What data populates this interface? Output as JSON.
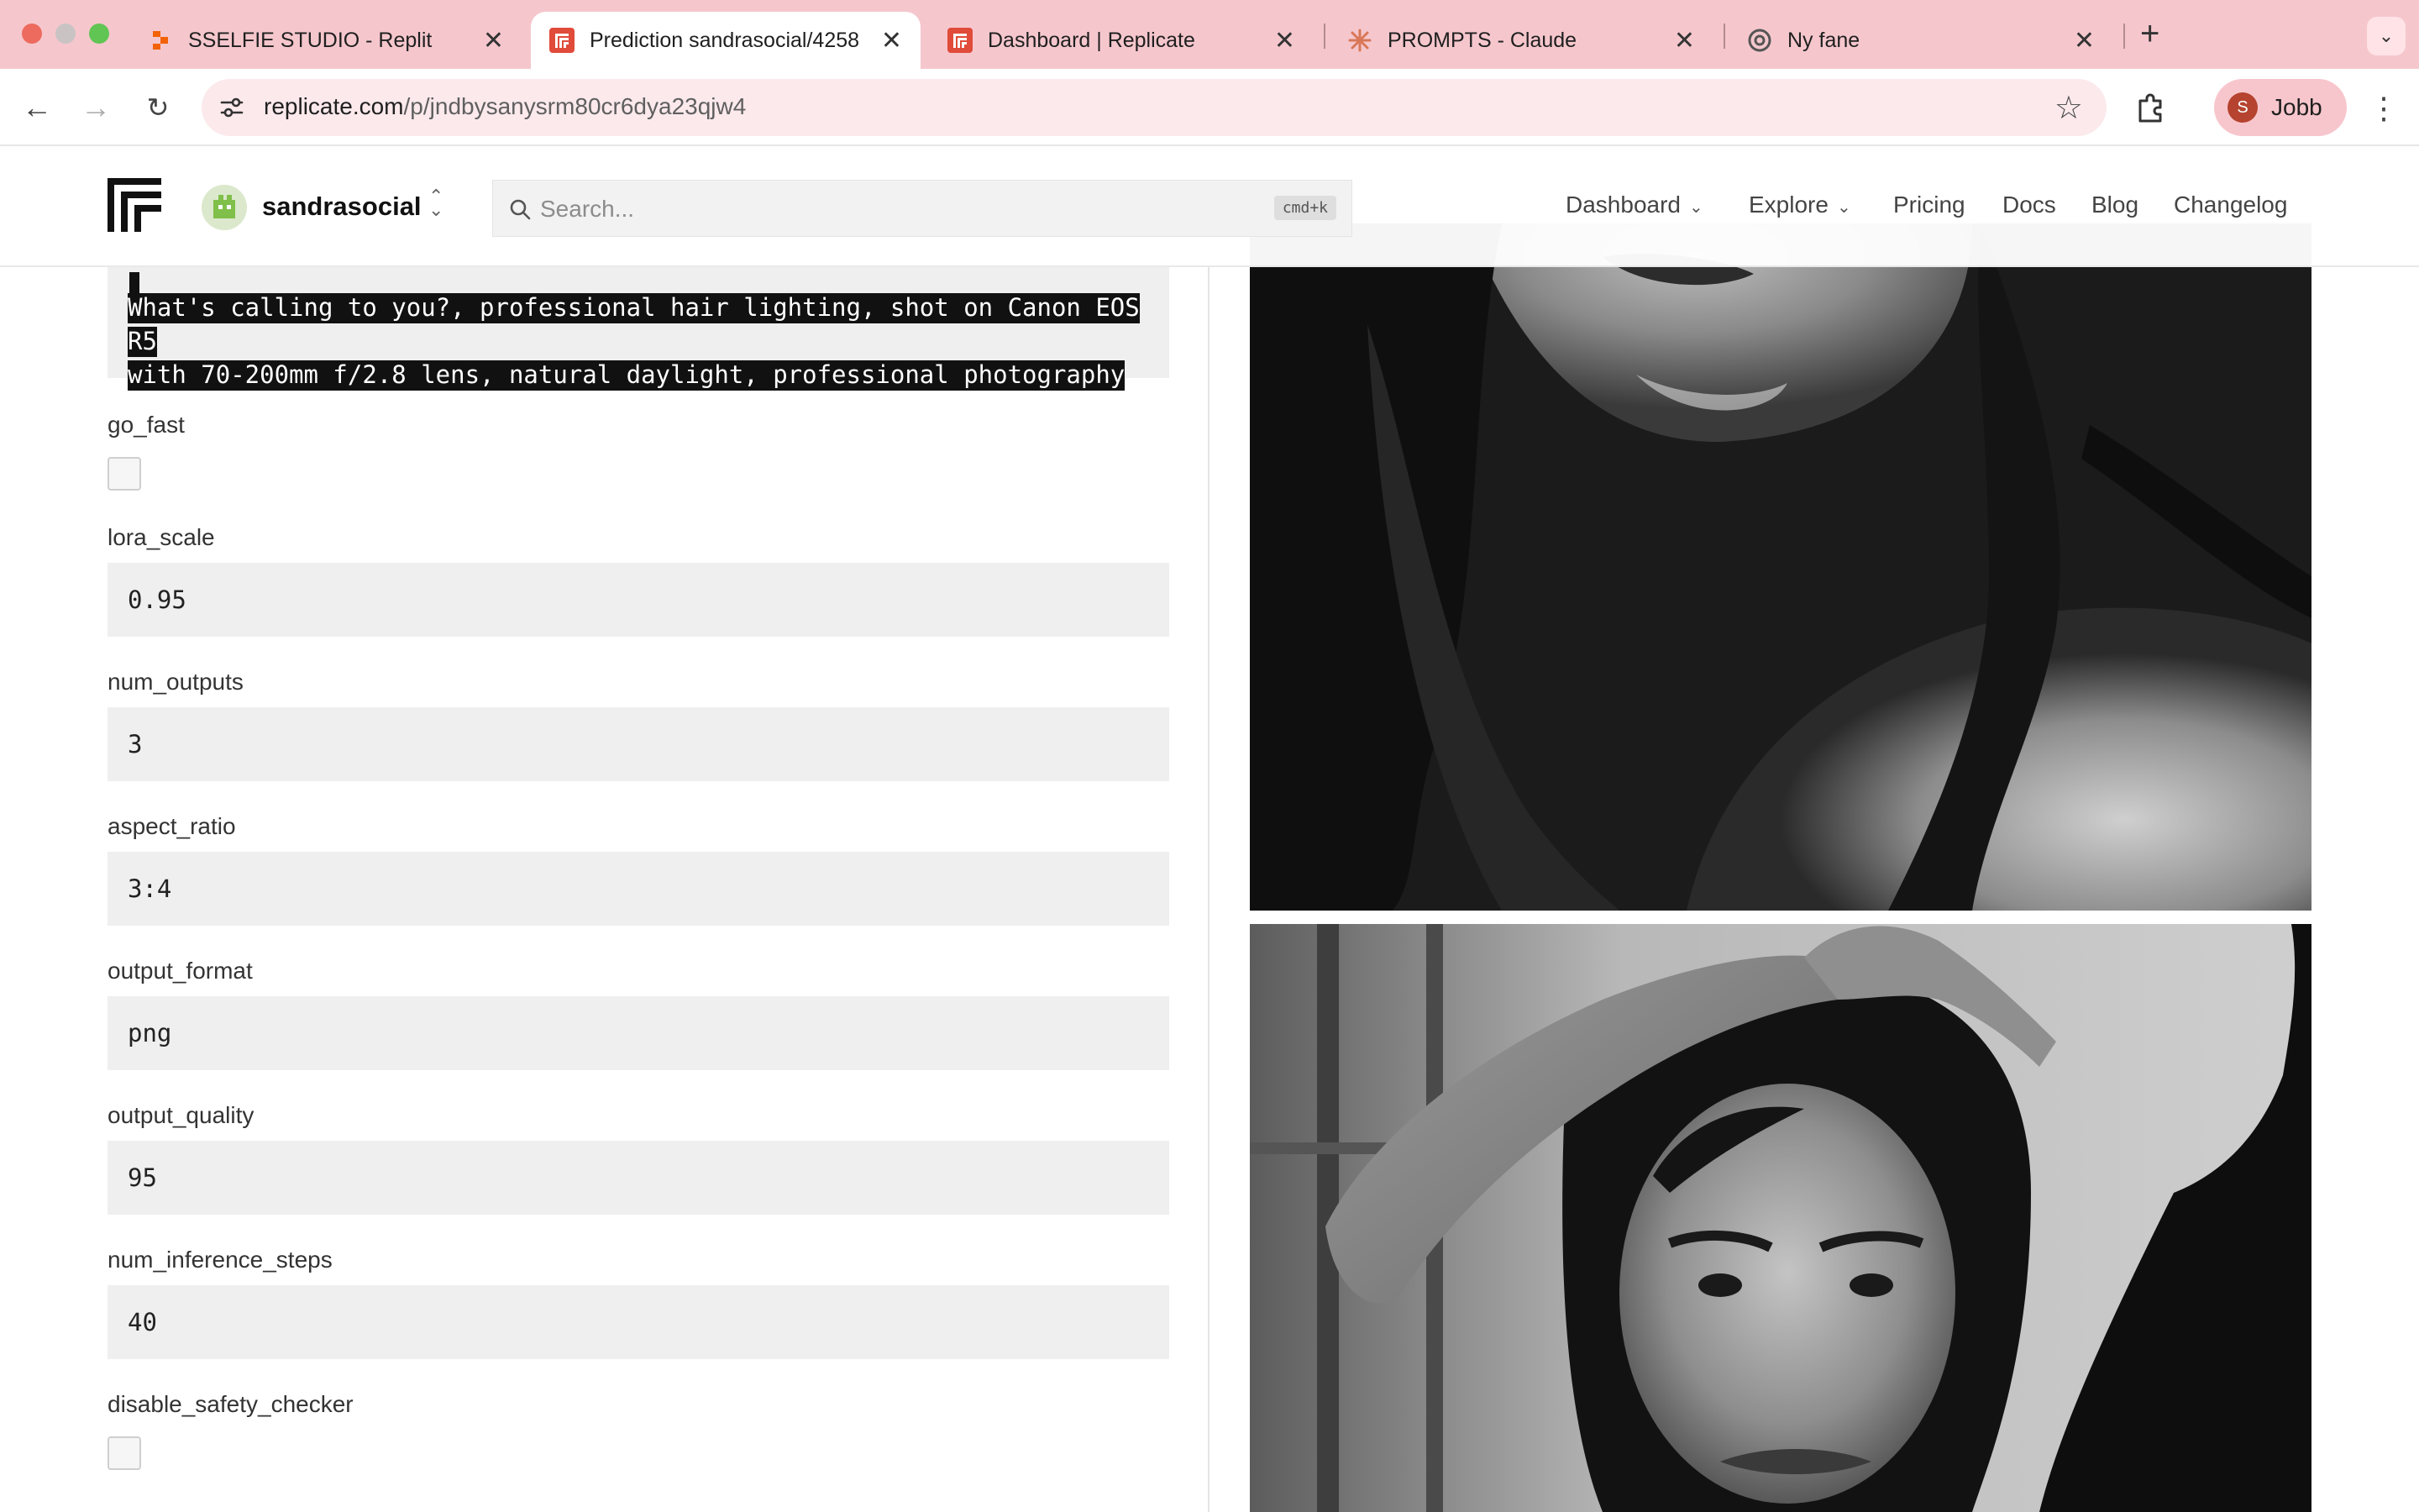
{
  "browser": {
    "tabs": [
      {
        "title": "SSELFIE STUDIO - Replit",
        "icon": "replit-icon"
      },
      {
        "title": "Prediction sandrasocial/4258",
        "icon": "replicate-icon"
      },
      {
        "title": "Dashboard | Replicate",
        "icon": "replicate-icon"
      },
      {
        "title": "PROMPTS - Claude",
        "icon": "claude-icon"
      },
      {
        "title": "Ny fane",
        "icon": "chrome-icon"
      }
    ],
    "url_host": "replicate.com",
    "url_path": "/p/jndbysanysrm80cr6dya23qjw4",
    "profile_initial": "S",
    "profile_name": "Jobb"
  },
  "site": {
    "account_name": "sandrasocial",
    "search_placeholder": "Search...",
    "search_shortcut": "cmd+k",
    "nav": [
      "Dashboard",
      "Explore",
      "Pricing",
      "Docs",
      "Blog",
      "Changelog"
    ]
  },
  "form": {
    "prompt_line1": "What's calling to you?, professional hair lighting, shot on Canon EOS R5",
    "prompt_line2": "with 70-200mm f/2.8 lens, natural daylight, professional photography",
    "fields": {
      "go_fast": {
        "label": "go_fast",
        "checked": false
      },
      "lora_scale": {
        "label": "lora_scale",
        "value": "0.95"
      },
      "num_outputs": {
        "label": "num_outputs",
        "value": "3"
      },
      "aspect_ratio": {
        "label": "aspect_ratio",
        "value": "3:4"
      },
      "output_format": {
        "label": "output_format",
        "value": "png"
      },
      "output_quality": {
        "label": "output_quality",
        "value": "95"
      },
      "num_inference_steps": {
        "label": "num_inference_steps",
        "value": "40"
      },
      "disable_safety_checker": {
        "label": "disable_safety_checker",
        "checked": false
      }
    }
  },
  "colors": {
    "tabstrip": "#f5c7cd",
    "omnibox": "#fbe9ec",
    "input_bg": "#efefef",
    "replicate_red": "#e04b3a"
  }
}
